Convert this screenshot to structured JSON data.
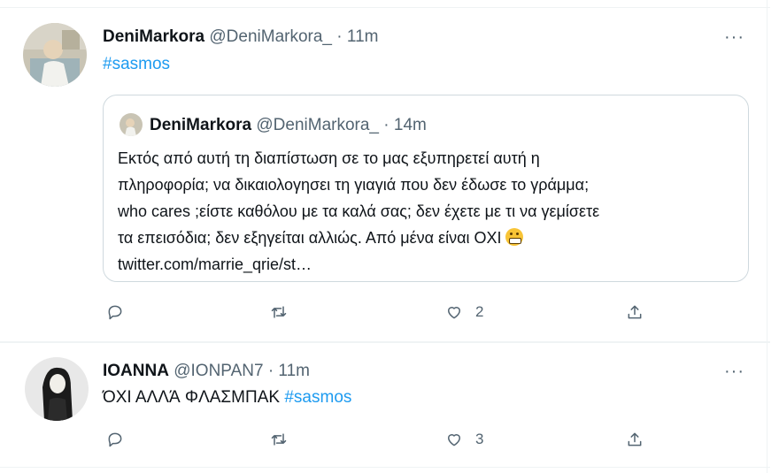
{
  "tweets": [
    {
      "name": "DeniMarkora",
      "handle": "@DeniMarkora_",
      "dot": "·",
      "time": "11m",
      "more": "···",
      "hashtag": "#sasmos",
      "quote": {
        "name": "DeniMarkora",
        "handle": "@DeniMarkora_",
        "dot": "·",
        "time": "14m",
        "lines": [
          "Εκτός από αυτή τη διαπίστωση σε το μας εξυπηρετεί αυτή η",
          "πληροφορία; να δικαιολογησει τη γιαγιά που δεν έδωσε το γράμμα;",
          "who cares ;είστε καθόλου με τα καλά σας; δεν έχετε με τι να γεμίσετε",
          "τα επεισόδια; δεν εξηγείται αλλιώς. Από μένα είναι ΟΧΙ",
          "twitter.com/marrie_qrie/st…"
        ]
      },
      "actions": {
        "reply_icon": "reply-icon",
        "retweet_icon": "retweet-icon",
        "like_icon": "heart-icon",
        "like_count": "2",
        "share_icon": "share-icon"
      }
    },
    {
      "name": "IOANNA",
      "handle": "@IONPAN7",
      "dot": "·",
      "time": "11m",
      "more": "···",
      "text": "ΌΧΙ ΑΛΛΆ ΦΛΑΣΜΠΑΚ",
      "hashtag": "#sasmos",
      "actions": {
        "reply_icon": "reply-icon",
        "retweet_icon": "retweet-icon",
        "like_icon": "heart-icon",
        "like_count": "3",
        "share_icon": "share-icon"
      }
    }
  ],
  "colors": {
    "link": "#1d9bf0",
    "secondary": "#536471",
    "border": "#cfd9de",
    "divider": "#eff3f4"
  }
}
